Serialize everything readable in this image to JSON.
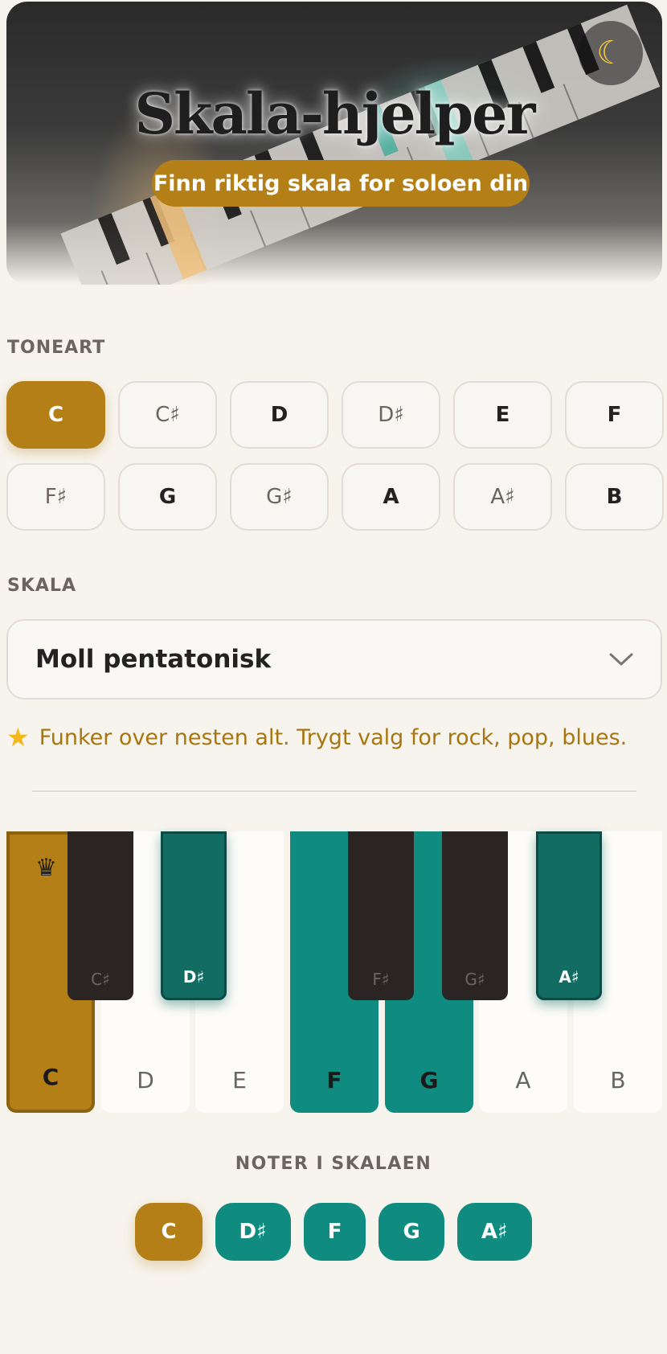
{
  "hero": {
    "title": "Skala-hjelper",
    "subtitle": "Finn riktig skala for soloen din",
    "theme_toggle_icon": "moon-icon"
  },
  "key_section": {
    "label": "TONEART",
    "selected": "C",
    "keys": [
      "C",
      "C♯",
      "D",
      "D♯",
      "E",
      "F",
      "F♯",
      "G",
      "G♯",
      "A",
      "A♯",
      "B"
    ]
  },
  "scale_section": {
    "label": "SKALA",
    "selected": "Moll pentatonisk",
    "tip": "Funker over nesten alt. Trygt valg for rock, pop, blues."
  },
  "piano": {
    "white_keys": [
      {
        "note": "C",
        "state": "root"
      },
      {
        "note": "D",
        "state": "off"
      },
      {
        "note": "E",
        "state": "off"
      },
      {
        "note": "F",
        "state": "in"
      },
      {
        "note": "G",
        "state": "in"
      },
      {
        "note": "A",
        "state": "off"
      },
      {
        "note": "B",
        "state": "off"
      }
    ],
    "black_keys": [
      {
        "note": "C♯",
        "state": "off"
      },
      {
        "note": "D♯",
        "state": "in"
      },
      {
        "note": "F♯",
        "state": "off"
      },
      {
        "note": "G♯",
        "state": "off"
      },
      {
        "note": "A♯",
        "state": "in"
      }
    ]
  },
  "notes_section": {
    "label": "NOTER I SKALAEN",
    "notes": [
      "C",
      "D♯",
      "F",
      "G",
      "A♯"
    ]
  },
  "colors": {
    "accent_gold": "#b37f16",
    "scale_teal": "#0f8b80",
    "background": "#f7f4ee"
  }
}
